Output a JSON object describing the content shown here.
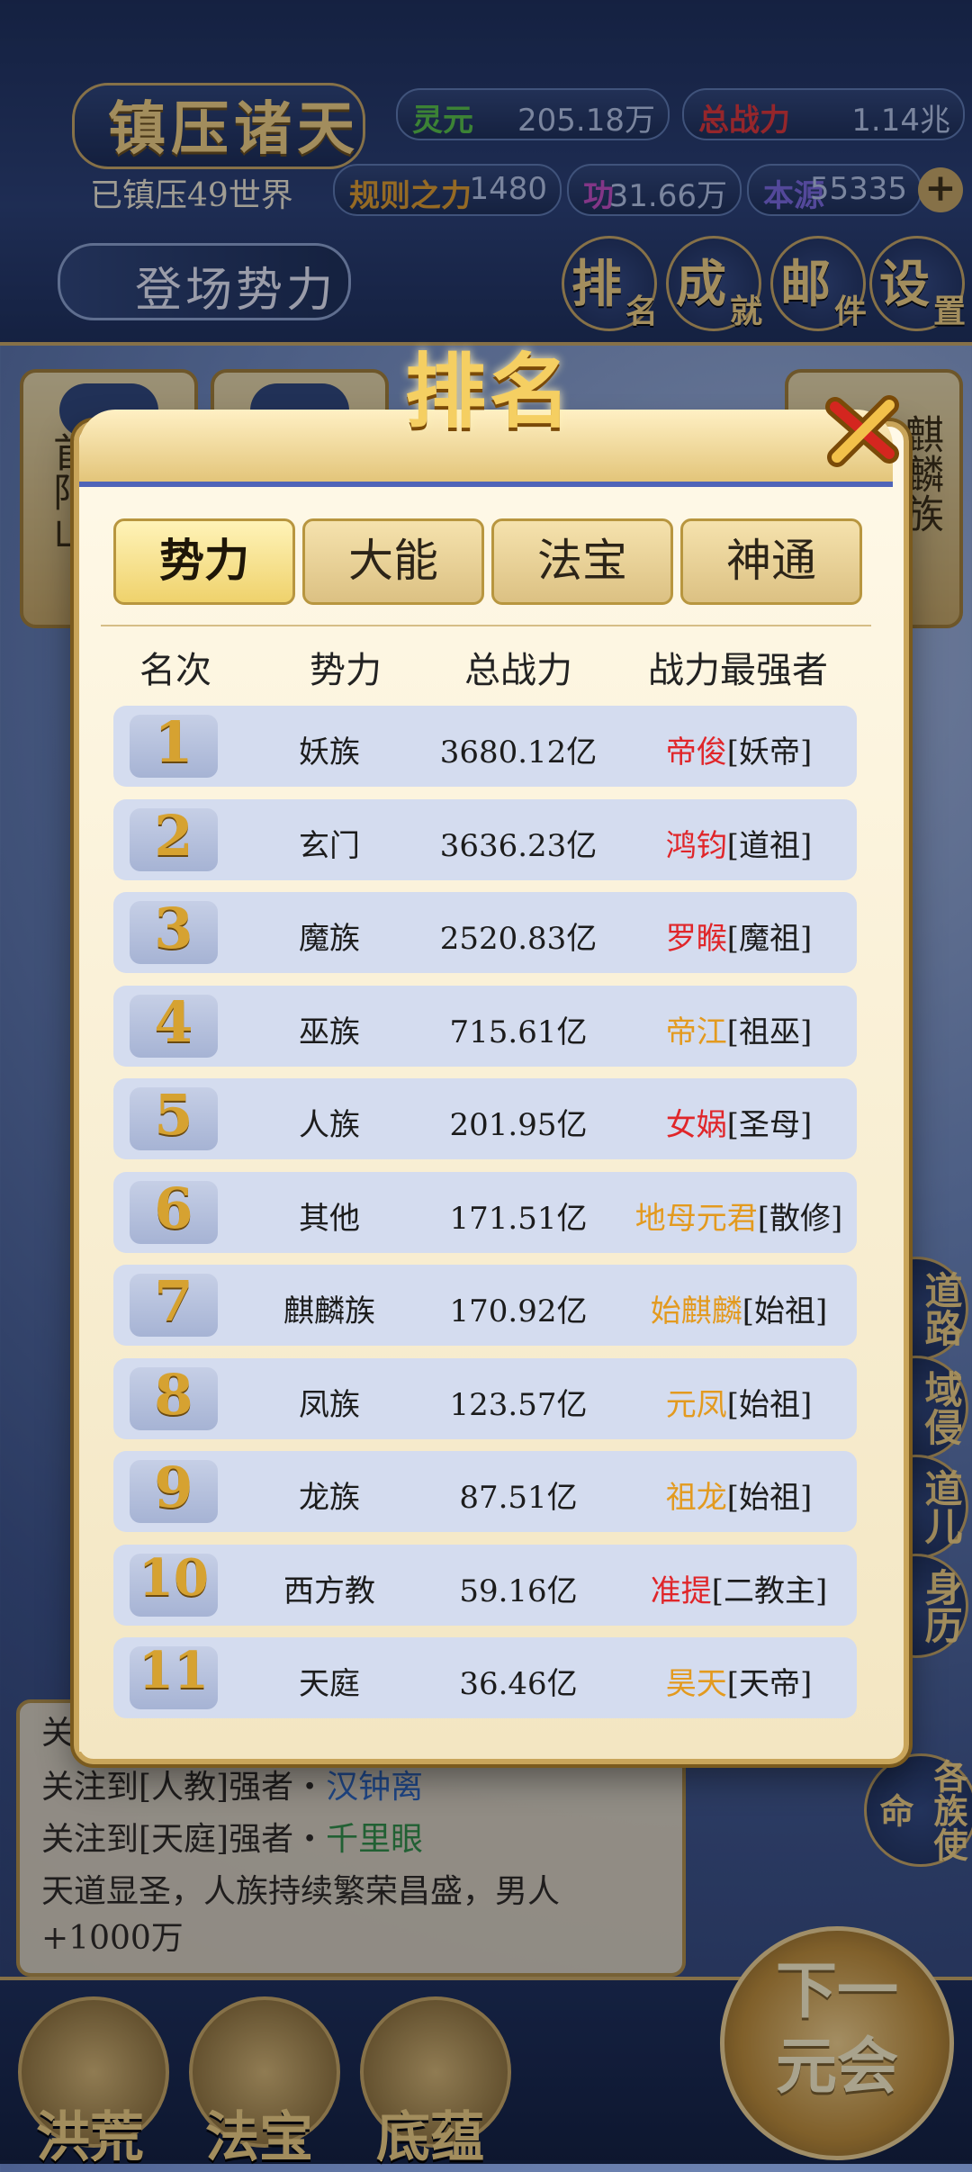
{
  "header": {
    "title": "镇压诸天",
    "subtitle": "已镇压49世界",
    "debut_label": "登场势力",
    "stats": [
      {
        "label": "灵元",
        "value": "205.18万",
        "label_color": "#58c03c"
      },
      {
        "label": "总战力",
        "value": "1.14兆",
        "label_color": "#e0322d"
      },
      {
        "label": "规则之力",
        "value": "1480",
        "label_color": "#e09a22"
      },
      {
        "label": "功",
        "value": "31.66万",
        "label_color": "#c54bbb"
      },
      {
        "label": "本源",
        "value": "55335",
        "label_color": "#7b66d8"
      }
    ],
    "top_buttons": [
      {
        "a": "排",
        "b": "名"
      },
      {
        "a": "成",
        "b": "就"
      },
      {
        "a": "邮",
        "b": "件"
      },
      {
        "a": "设",
        "b": "置"
      }
    ]
  },
  "background_cards": [
    {
      "text": "首阳山"
    },
    {
      "text": ""
    },
    {
      "text": ""
    },
    {
      "text": ""
    },
    {
      "text": "麒麟族"
    }
  ],
  "side_buttons": [
    "道路",
    "域侵",
    "道儿",
    "身历",
    "各族使命"
  ],
  "news": {
    "lines": [
      {
        "prefix": "关注到[人教]强者・",
        "name": "汉钟离"
      },
      {
        "prefix": "关注到[天庭]强者・",
        "name": "千里眼"
      }
    ],
    "body_line1": "天道显圣，人族持续繁荣昌盛，男人",
    "body_line2": "+1000万",
    "first_prefix": "关"
  },
  "bottom_nav": {
    "items": [
      "洪荒",
      "法宝",
      "底蕴"
    ],
    "next_label": "下一元会"
  },
  "modal": {
    "title": "排名",
    "tabs": [
      "势力",
      "大能",
      "法宝",
      "神通"
    ],
    "active_tab": 0,
    "columns": [
      "名次",
      "势力",
      "总战力",
      "战力最强者"
    ],
    "rows": [
      {
        "rank": "1",
        "faction": "妖族",
        "power": "3680.12亿",
        "champion": "帝俊",
        "title": "[妖帝]",
        "color": "red"
      },
      {
        "rank": "2",
        "faction": "玄门",
        "power": "3636.23亿",
        "champion": "鸿钧",
        "title": "[道祖]",
        "color": "red"
      },
      {
        "rank": "3",
        "faction": "魔族",
        "power": "2520.83亿",
        "champion": "罗睺",
        "title": "[魔祖]",
        "color": "red"
      },
      {
        "rank": "4",
        "faction": "巫族",
        "power": "715.61亿",
        "champion": "帝江",
        "title": "[祖巫]",
        "color": "orange"
      },
      {
        "rank": "5",
        "faction": "人族",
        "power": "201.95亿",
        "champion": "女娲",
        "title": "[圣母]",
        "color": "red"
      },
      {
        "rank": "6",
        "faction": "其他",
        "power": "171.51亿",
        "champion": "地母元君",
        "title": "[散修]",
        "color": "orange"
      },
      {
        "rank": "7",
        "faction": "麒麟族",
        "power": "170.92亿",
        "champion": "始麒麟",
        "title": "[始祖]",
        "color": "orange"
      },
      {
        "rank": "8",
        "faction": "凤族",
        "power": "123.57亿",
        "champion": "元凤",
        "title": "[始祖]",
        "color": "orange"
      },
      {
        "rank": "9",
        "faction": "龙族",
        "power": "87.51亿",
        "champion": "祖龙",
        "title": "[始祖]",
        "color": "orange"
      },
      {
        "rank": "10",
        "faction": "西方教",
        "power": "59.16亿",
        "champion": "准提",
        "title": "[二教主]",
        "color": "red"
      },
      {
        "rank": "11",
        "faction": "天庭",
        "power": "36.46亿",
        "champion": "昊天",
        "title": "[天帝]",
        "color": "orange"
      }
    ]
  }
}
